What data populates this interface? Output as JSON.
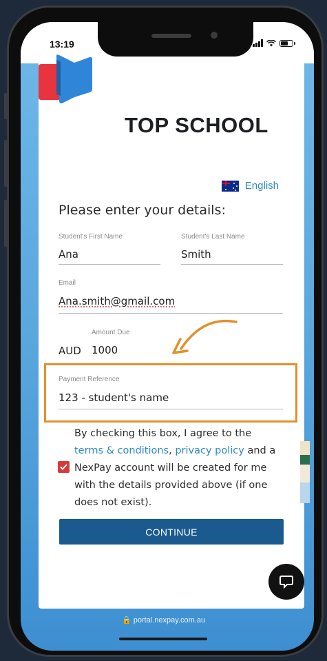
{
  "status_bar": {
    "time": "13:19"
  },
  "brand": {
    "name": "TOP SCHOOL"
  },
  "language": {
    "label": "English",
    "flag": "australia-flag-icon"
  },
  "form": {
    "heading": "Please enter your details:",
    "first_name": {
      "label": "Student's First Name",
      "value": "Ana"
    },
    "last_name": {
      "label": "Student's Last Name",
      "value": "Smith"
    },
    "email": {
      "label": "Email",
      "value": "Ana.smith@gmail.com"
    },
    "amount": {
      "label": "Amount Due",
      "currency": "AUD",
      "value": "1000"
    },
    "payment_reference": {
      "label": "Payment Reference",
      "value": "123 - student's name"
    }
  },
  "consent": {
    "text_1": "By checking this box, I agree to the ",
    "terms_link": "terms & conditions",
    "text_2": ", ",
    "privacy_link": "privacy policy",
    "text_3": " and a NexPay account will be created for me with the details provided above (if one does not exist).",
    "checked": true
  },
  "continue_button": {
    "label": "CONTINUE"
  },
  "browser": {
    "url": "portal.nexpay.com.au"
  },
  "colors": {
    "accent_blue": "#2e89c8",
    "button_blue": "#1b5a8e",
    "highlight_orange": "#e3902a",
    "checkbox_red": "#d63a3a"
  }
}
